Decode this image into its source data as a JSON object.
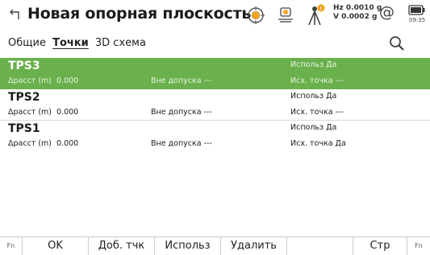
{
  "header": {
    "title": "Новая опорная плоскость",
    "hz_label": "Hz 0.0010 g",
    "v_label": "V  0.0002 g",
    "at_symbol": "@",
    "time": "09:35"
  },
  "tabs": [
    {
      "label": "Общие",
      "active": false
    },
    {
      "label": "Точки",
      "active": true
    },
    {
      "label": "3D схема",
      "active": false
    }
  ],
  "rows": [
    {
      "name": "TPS3",
      "dist_label": "Δрасст (m)",
      "dist_value": "0.000",
      "tol_label": "Вне допуска",
      "tol_value": "---",
      "use_label": "Использ",
      "use_value": "Да",
      "src_label": "Исх. точка",
      "src_value": "---",
      "selected": true
    },
    {
      "name": "TPS2",
      "dist_label": "Δрасст (m)",
      "dist_value": "0.000",
      "tol_label": "Вне допуска",
      "tol_value": "---",
      "use_label": "Использ",
      "use_value": "Да",
      "src_label": "Исх. точка",
      "src_value": "---",
      "selected": false
    },
    {
      "name": "TPS1",
      "dist_label": "Δрасст (m)",
      "dist_value": "0.000",
      "tol_label": "Вне допуска",
      "tol_value": "---",
      "use_label": "Использ",
      "use_value": "Да",
      "src_label": "Исх. точка",
      "src_value": "Да",
      "selected": false
    }
  ],
  "softkeys": {
    "fn_left": "Fn",
    "ok": "OK",
    "add_point": "Доб. тчк",
    "use": "Использ",
    "delete": "Удалить",
    "empty": "",
    "page": "Стр",
    "fn_right": "Fn"
  },
  "colors": {
    "selected_row": "#6ab04c",
    "accent_orange": "#f39c12"
  }
}
